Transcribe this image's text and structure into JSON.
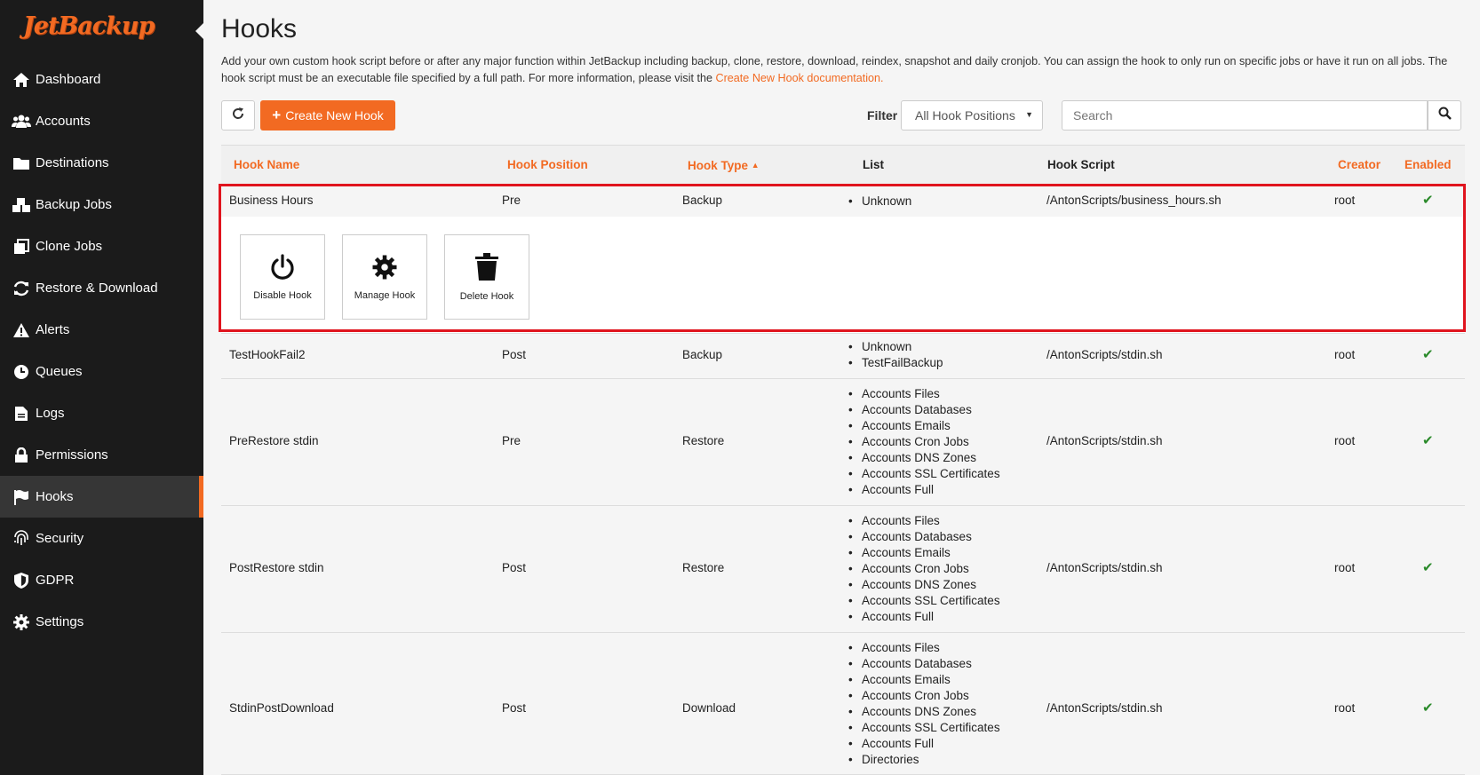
{
  "brand": {
    "logo_text": "JetBackup",
    "accent": "#f26a22"
  },
  "sidebar": {
    "items": [
      {
        "label": "Dashboard",
        "icon": "home-icon"
      },
      {
        "label": "Accounts",
        "icon": "users-icon"
      },
      {
        "label": "Destinations",
        "icon": "folder-icon"
      },
      {
        "label": "Backup Jobs",
        "icon": "cubes-icon"
      },
      {
        "label": "Clone Jobs",
        "icon": "copy-icon"
      },
      {
        "label": "Restore & Download",
        "icon": "refresh-icon"
      },
      {
        "label": "Alerts",
        "icon": "warning-icon"
      },
      {
        "label": "Queues",
        "icon": "clock-icon"
      },
      {
        "label": "Logs",
        "icon": "file-icon"
      },
      {
        "label": "Permissions",
        "icon": "lock-icon"
      },
      {
        "label": "Hooks",
        "icon": "flag-icon",
        "active": true
      },
      {
        "label": "Security",
        "icon": "fingerprint-icon"
      },
      {
        "label": "GDPR",
        "icon": "shield-icon"
      },
      {
        "label": "Settings",
        "icon": "gear-icon"
      }
    ]
  },
  "page": {
    "title": "Hooks",
    "description": "Add your own custom hook script before or after any major function within JetBackup including backup, clone, restore, download, reindex, snapshot and daily cronjob. You can assign the hook to only run on specific jobs or have it run on all jobs. The hook script must be an executable file specified by a full path. For more information, please visit the ",
    "doc_link": "Create New Hook documentation."
  },
  "toolbar": {
    "create_label": "Create New Hook",
    "filter_label": "Filter",
    "filter_value": "All Hook Positions",
    "search_placeholder": "Search"
  },
  "table": {
    "headers": {
      "name": "Hook Name",
      "position": "Hook Position",
      "type": "Hook Type",
      "list": "List",
      "script": "Hook Script",
      "creator": "Creator",
      "enabled": "Enabled"
    },
    "rows": [
      {
        "name": "Business Hours",
        "position": "Pre",
        "type": "Backup",
        "list": [
          "Unknown"
        ],
        "script": "/AntonScripts/business_hours.sh",
        "creator": "root",
        "enabled": "✔"
      },
      {
        "name": "TestHookFail2",
        "position": "Post",
        "type": "Backup",
        "list": [
          "Unknown",
          "TestFailBackup"
        ],
        "script": "/AntonScripts/stdin.sh",
        "creator": "root",
        "enabled": "✔"
      },
      {
        "name": "PreRestore stdin",
        "position": "Pre",
        "type": "Restore",
        "list": [
          "Accounts Files",
          "Accounts Databases",
          "Accounts Emails",
          "Accounts Cron Jobs",
          "Accounts DNS Zones",
          "Accounts SSL Certificates",
          "Accounts Full"
        ],
        "script": "/AntonScripts/stdin.sh",
        "creator": "root",
        "enabled": "✔"
      },
      {
        "name": "PostRestore stdin",
        "position": "Post",
        "type": "Restore",
        "list": [
          "Accounts Files",
          "Accounts Databases",
          "Accounts Emails",
          "Accounts Cron Jobs",
          "Accounts DNS Zones",
          "Accounts SSL Certificates",
          "Accounts Full"
        ],
        "script": "/AntonScripts/stdin.sh",
        "creator": "root",
        "enabled": "✔"
      },
      {
        "name": "StdinPostDownload",
        "position": "Post",
        "type": "Download",
        "list": [
          "Accounts Files",
          "Accounts Databases",
          "Accounts Emails",
          "Accounts Cron Jobs",
          "Accounts DNS Zones",
          "Accounts SSL Certificates",
          "Accounts Full",
          "Directories"
        ],
        "script": "/AntonScripts/stdin.sh",
        "creator": "root",
        "enabled": "✔"
      }
    ],
    "actions": {
      "disable": "Disable Hook",
      "manage": "Manage Hook",
      "delete": "Delete Hook"
    }
  }
}
